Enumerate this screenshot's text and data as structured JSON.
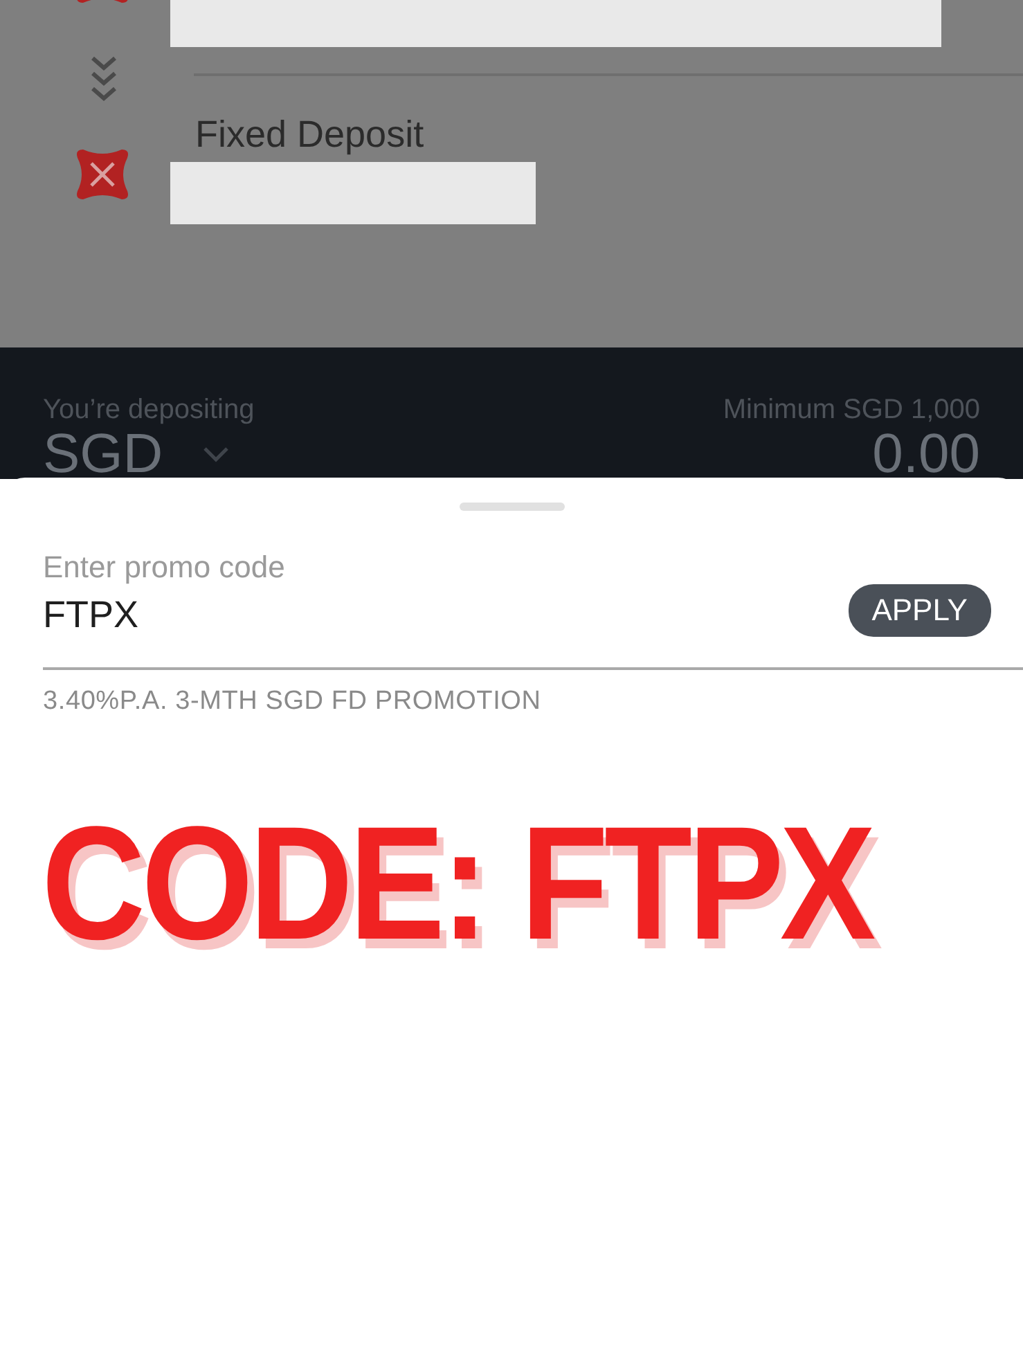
{
  "transfer": {
    "to_account": "Fixed Deposit"
  },
  "deposit_bar": {
    "label": "You’re depositing",
    "minimum": "Minimum SGD 1,000",
    "currency": "SGD",
    "amount": "0.00"
  },
  "promo_sheet": {
    "field": {
      "label": "Enter promo code",
      "value": "FTPX"
    },
    "apply_button": "APPLY",
    "promotion": "3.40%P.A. 3-MTH SGD FD PROMOTION"
  },
  "annotation": "CODE: FTPX"
}
